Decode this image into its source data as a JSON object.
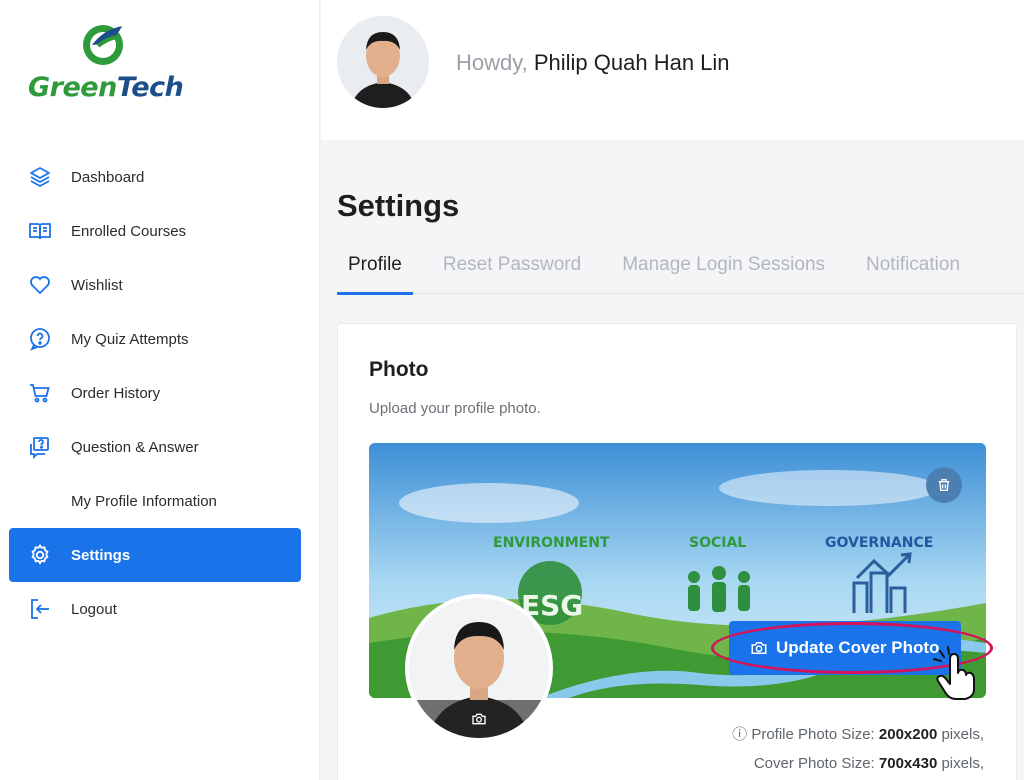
{
  "brand": {
    "name_part1": "Green",
    "name_part2": "Tech"
  },
  "sidebar": {
    "items": [
      {
        "label": "Dashboard",
        "icon": "layers-icon"
      },
      {
        "label": "Enrolled Courses",
        "icon": "open-book-icon"
      },
      {
        "label": "Wishlist",
        "icon": "heart-icon"
      },
      {
        "label": "My Quiz Attempts",
        "icon": "question-bubble-icon"
      },
      {
        "label": "Order History",
        "icon": "cart-icon"
      },
      {
        "label": "Question & Answer",
        "icon": "qa-icon"
      },
      {
        "label": "My Profile Information",
        "icon": ""
      },
      {
        "label": "Settings",
        "icon": "gear-icon",
        "active": true
      },
      {
        "label": "Logout",
        "icon": "logout-icon"
      }
    ]
  },
  "header": {
    "greeting": "Howdy,",
    "user_name": "Philip Quah Han Lin"
  },
  "main": {
    "title": "Settings",
    "tabs": [
      {
        "label": "Profile",
        "active": true
      },
      {
        "label": "Reset Password"
      },
      {
        "label": "Manage Login Sessions"
      },
      {
        "label": "Notification"
      }
    ],
    "photo_section": {
      "title": "Photo",
      "subtitle": "Upload your profile photo.",
      "cover_labels": [
        "ENVIRONMENT",
        "SOCIAL",
        "GOVERNANCE"
      ],
      "cover_badge": "ESG",
      "update_cover_label": "Update Cover Photo",
      "profile_size_label": "Profile Photo Size:",
      "profile_size_value": "200x200",
      "cover_size_label": "Cover Photo Size:",
      "cover_size_value": "700x430",
      "size_unit": "pixels,"
    }
  },
  "colors": {
    "accent": "#1a73e8",
    "highlight": "#d4145a",
    "brand_green": "#2e9a3a",
    "brand_navy": "#1c4f8a"
  }
}
